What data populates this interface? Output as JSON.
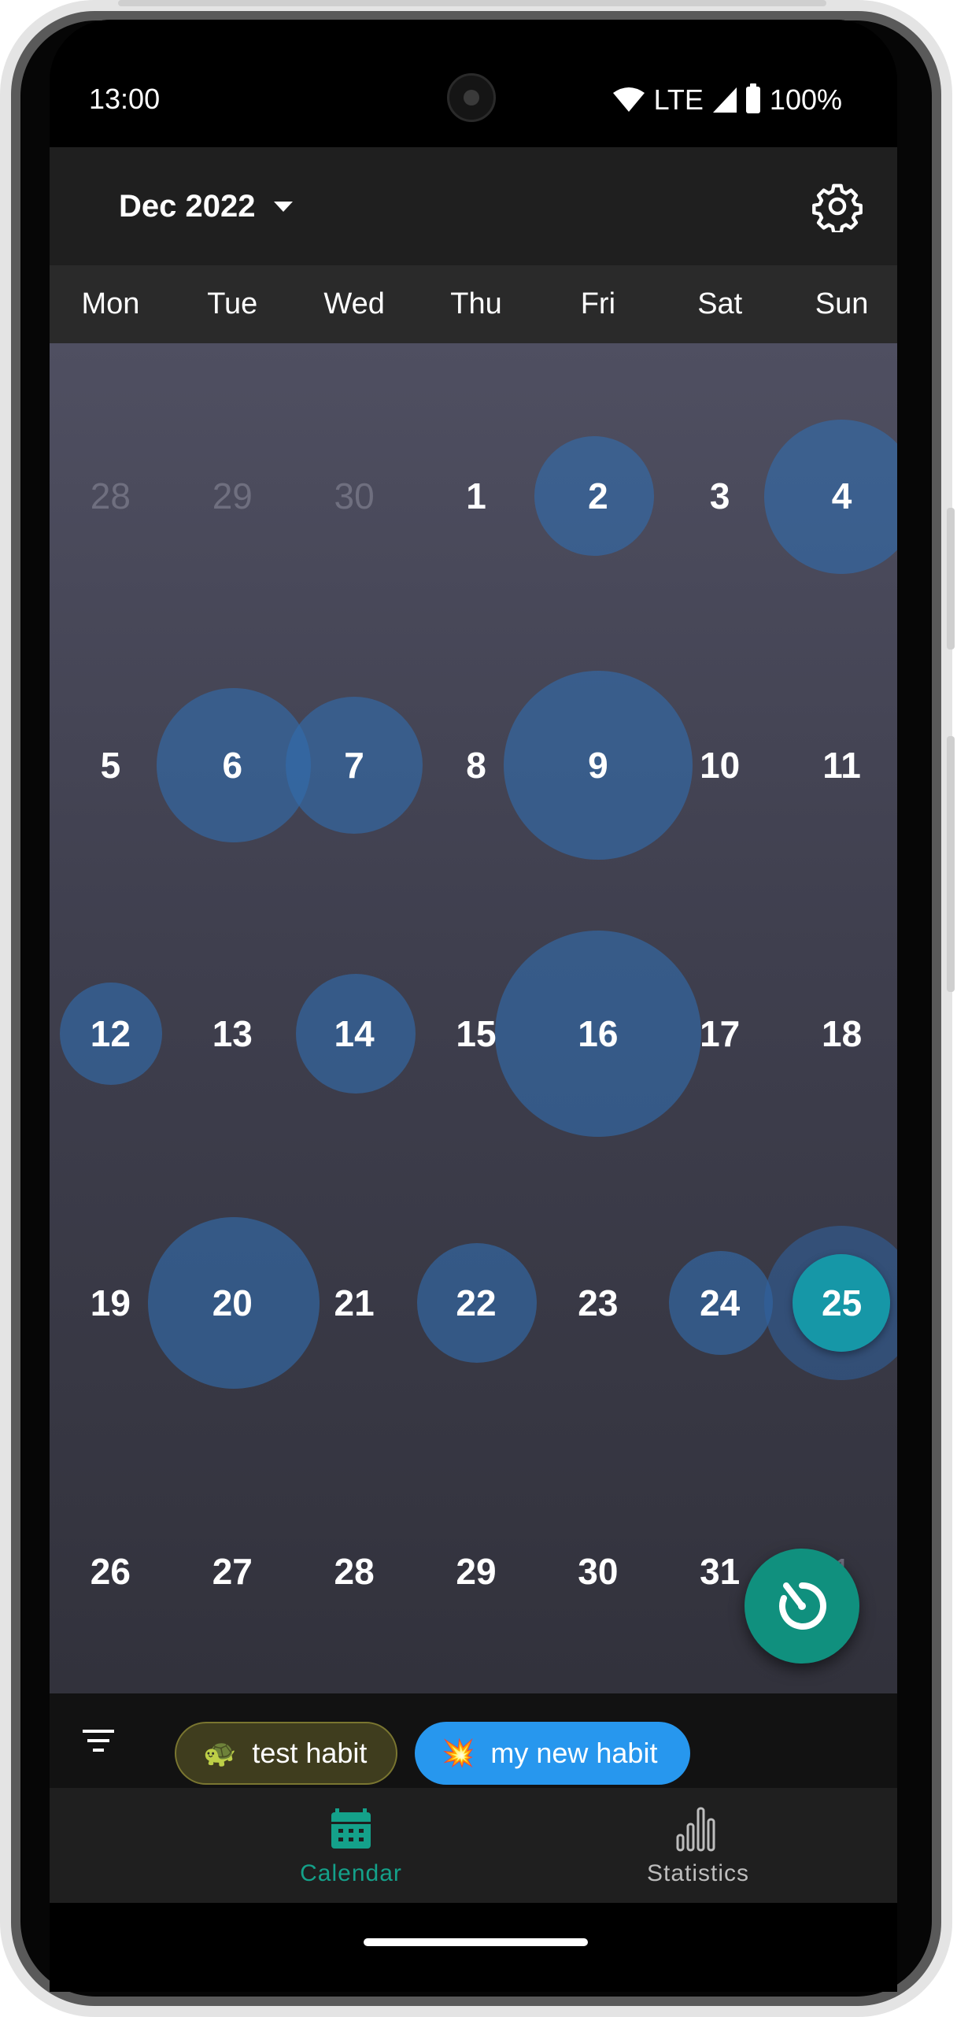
{
  "status_bar": {
    "time": "13:00",
    "network": "LTE",
    "battery": "100%"
  },
  "header": {
    "month_label": "Dec 2022"
  },
  "weekdays": [
    "Mon",
    "Tue",
    "Wed",
    "Thu",
    "Fri",
    "Sat",
    "Sun"
  ],
  "calendar": {
    "weeks": [
      [
        "28",
        "29",
        "30",
        "1",
        "2",
        "3",
        "4"
      ],
      [
        "5",
        "6",
        "7",
        "8",
        "9",
        "10",
        "11"
      ],
      [
        "12",
        "13",
        "14",
        "15",
        "16",
        "17",
        "18"
      ],
      [
        "19",
        "20",
        "21",
        "22",
        "23",
        "24",
        "25"
      ],
      [
        "26",
        "27",
        "28",
        "29",
        "30",
        "31",
        "1"
      ]
    ],
    "today": "25"
  },
  "filters": {
    "chips": [
      {
        "emoji": "🐢",
        "label": "test habit"
      },
      {
        "emoji": "💥",
        "label": "my new habit"
      }
    ]
  },
  "nav": {
    "calendar_label": "Calendar",
    "statistics_label": "Statistics"
  },
  "colors": {
    "accent": "#14a18a",
    "bubble": "#326cac",
    "today": "#159baa",
    "chip_blue": "#2797ee"
  }
}
